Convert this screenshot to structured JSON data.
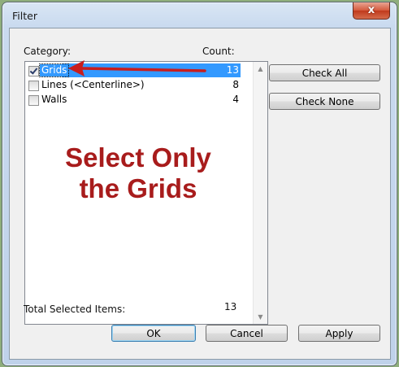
{
  "window": {
    "title": "Filter",
    "close_glyph": "x"
  },
  "labels": {
    "category": "Category:",
    "count": "Count:",
    "total_selected": "Total Selected Items:",
    "total_selected_value": "13"
  },
  "categories": [
    {
      "label": "Grids",
      "count": "13",
      "checked": true,
      "selected": true
    },
    {
      "label": "Lines (<Centerline>)",
      "count": "8",
      "checked": false,
      "selected": false
    },
    {
      "label": "Walls",
      "count": "4",
      "checked": false,
      "selected": false
    }
  ],
  "buttons": {
    "check_all": "Check All",
    "check_none": "Check None",
    "ok": "OK",
    "cancel": "Cancel",
    "apply": "Apply"
  },
  "annotation": {
    "line1": "Select Only",
    "line2": "the Grids",
    "color": "#a81c1c"
  },
  "icons": {
    "scroll_up": "scroll-up-arrow-icon",
    "scroll_down": "scroll-down-arrow-icon",
    "pointer": "red-arrow-icon"
  }
}
